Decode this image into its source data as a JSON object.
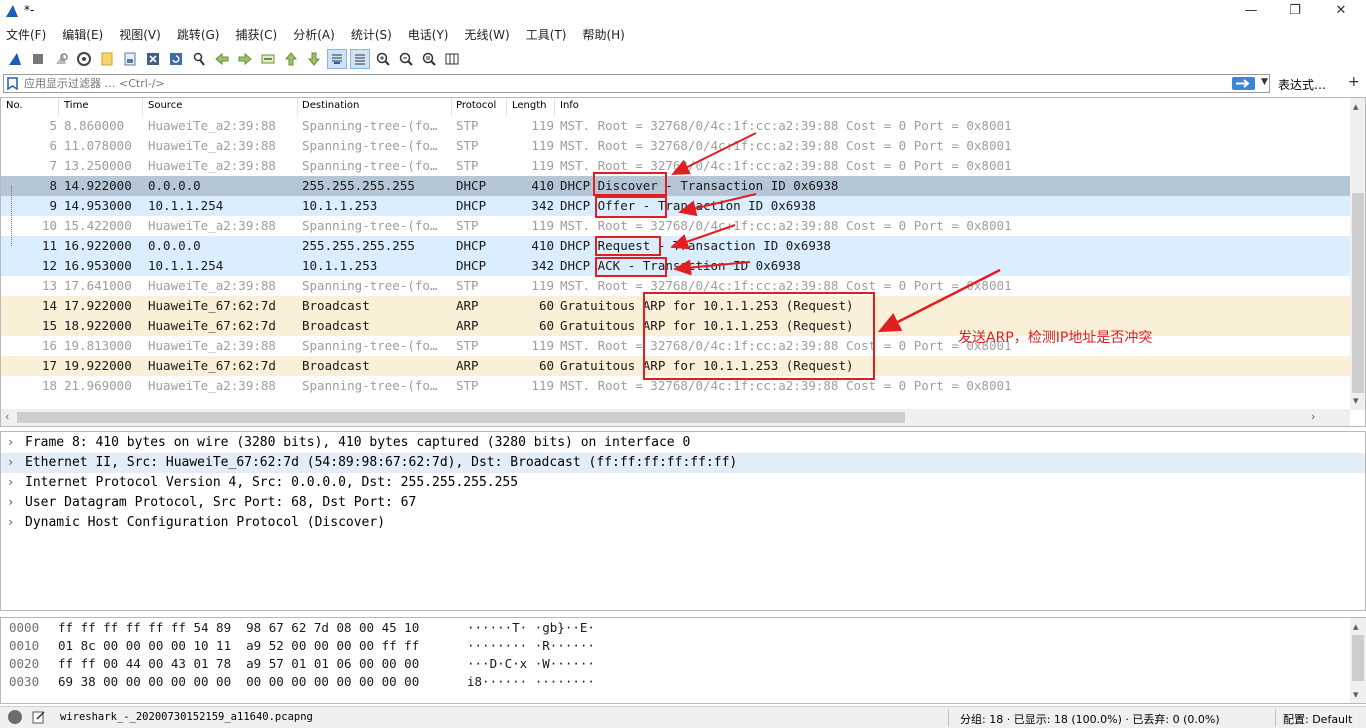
{
  "window": {
    "title": "*-",
    "minimize": "—",
    "maximize": "❐",
    "close": "✕"
  },
  "menus": [
    "文件(F)",
    "编辑(E)",
    "视图(V)",
    "跳转(G)",
    "捕获(C)",
    "分析(A)",
    "统计(S)",
    "电话(Y)",
    "无线(W)",
    "工具(T)",
    "帮助(H)"
  ],
  "toolbar": {
    "icons": [
      "shark-fin-start-icon",
      "stop-icon",
      "restart-icon",
      "capture-options-icon",
      "open-file-icon",
      "save-file-icon",
      "close-file-icon",
      "reload-icon",
      "find-icon",
      "go-back-icon",
      "go-forward-icon",
      "go-to-packet-icon",
      "go-first-icon",
      "go-last-icon",
      "autoscroll-icon",
      "colorize-icon",
      "zoom-in-icon",
      "zoom-out-icon",
      "zoom-normal-icon",
      "resize-columns-icon"
    ]
  },
  "filter": {
    "placeholder": "应用显示过滤器 … <Ctrl-/>",
    "expression_label": "表达式…",
    "add_label": "+"
  },
  "packet_list": {
    "columns": [
      "No.",
      "Time",
      "Source",
      "Destination",
      "Protocol",
      "Length",
      "Info"
    ],
    "rows": [
      {
        "no": "5",
        "time": "8.860000",
        "src": "HuaweiTe_a2:39:88",
        "dst": "Spanning-tree-(fo…",
        "proto": "STP",
        "len": "119",
        "info": "MST. Root = 32768/0/4c:1f:cc:a2:39:88  Cost = 0  Port = 0x8001",
        "kind": "stp"
      },
      {
        "no": "6",
        "time": "11.078000",
        "src": "HuaweiTe_a2:39:88",
        "dst": "Spanning-tree-(fo…",
        "proto": "STP",
        "len": "119",
        "info": "MST. Root = 32768/0/4c:1f:cc:a2:39:88  Cost = 0  Port = 0x8001",
        "kind": "stp"
      },
      {
        "no": "7",
        "time": "13.250000",
        "src": "HuaweiTe_a2:39:88",
        "dst": "Spanning-tree-(fo…",
        "proto": "STP",
        "len": "119",
        "info": "MST. Root = 32768/0/4c:1f:cc:a2:39:88  Cost = 0  Port = 0x8001",
        "kind": "stp"
      },
      {
        "no": "8",
        "time": "14.922000",
        "src": "0.0.0.0",
        "dst": "255.255.255.255",
        "proto": "DHCP",
        "len": "410",
        "info": "DHCP Discover - Transaction ID 0x6938",
        "kind": "dhcp sel"
      },
      {
        "no": "9",
        "time": "14.953000",
        "src": "10.1.1.254",
        "dst": "10.1.1.253",
        "proto": "DHCP",
        "len": "342",
        "info": "DHCP Offer    - Transaction ID 0x6938",
        "kind": "dhcp"
      },
      {
        "no": "10",
        "time": "15.422000",
        "src": "HuaweiTe_a2:39:88",
        "dst": "Spanning-tree-(fo…",
        "proto": "STP",
        "len": "119",
        "info": "MST. Root = 32768/0/4c:1f:cc:a2:39:88  Cost = 0  Port = 0x8001",
        "kind": "stp"
      },
      {
        "no": "11",
        "time": "16.922000",
        "src": "0.0.0.0",
        "dst": "255.255.255.255",
        "proto": "DHCP",
        "len": "410",
        "info": "DHCP Request  - Transaction ID 0x6938",
        "kind": "dhcp"
      },
      {
        "no": "12",
        "time": "16.953000",
        "src": "10.1.1.254",
        "dst": "10.1.1.253",
        "proto": "DHCP",
        "len": "342",
        "info": "DHCP ACK      - Transaction ID 0x6938",
        "kind": "dhcp"
      },
      {
        "no": "13",
        "time": "17.641000",
        "src": "HuaweiTe_a2:39:88",
        "dst": "Spanning-tree-(fo…",
        "proto": "STP",
        "len": "119",
        "info": "MST. Root = 32768/0/4c:1f:cc:a2:39:88  Cost = 0  Port = 0x8001",
        "kind": "stp"
      },
      {
        "no": "14",
        "time": "17.922000",
        "src": "HuaweiTe_67:62:7d",
        "dst": "Broadcast",
        "proto": "ARP",
        "len": "60",
        "info": "Gratuitous ARP for 10.1.1.253 (Request)",
        "kind": "arp"
      },
      {
        "no": "15",
        "time": "18.922000",
        "src": "HuaweiTe_67:62:7d",
        "dst": "Broadcast",
        "proto": "ARP",
        "len": "60",
        "info": "Gratuitous ARP for 10.1.1.253 (Request)",
        "kind": "arp"
      },
      {
        "no": "16",
        "time": "19.813000",
        "src": "HuaweiTe_a2:39:88",
        "dst": "Spanning-tree-(fo…",
        "proto": "STP",
        "len": "119",
        "info": "MST. Root = 32768/0/4c:1f:cc:a2:39:88  Cost = 0  Port = 0x8001",
        "kind": "stp"
      },
      {
        "no": "17",
        "time": "19.922000",
        "src": "HuaweiTe_67:62:7d",
        "dst": "Broadcast",
        "proto": "ARP",
        "len": "60",
        "info": "Gratuitous ARP for 10.1.1.253 (Request)",
        "kind": "arp"
      },
      {
        "no": "18",
        "time": "21.969000",
        "src": "HuaweiTe_a2:39:88",
        "dst": "Spanning-tree-(fo…",
        "proto": "STP",
        "len": "119",
        "info": "MST. Root = 32768/0/4c:1f:cc:a2:39:88  Cost = 0  Port = 0x8001",
        "kind": "stp"
      }
    ]
  },
  "details": [
    {
      "text": "Frame 8: 410 bytes on wire (3280 bits), 410 bytes captured (3280 bits) on interface 0",
      "hl": false
    },
    {
      "text": "Ethernet II, Src: HuaweiTe_67:62:7d (54:89:98:67:62:7d), Dst: Broadcast (ff:ff:ff:ff:ff:ff)",
      "hl": true
    },
    {
      "text": "Internet Protocol Version 4, Src: 0.0.0.0, Dst: 255.255.255.255",
      "hl": false
    },
    {
      "text": "User Datagram Protocol, Src Port: 68, Dst Port: 67",
      "hl": false
    },
    {
      "text": "Dynamic Host Configuration Protocol (Discover)",
      "hl": false
    }
  ],
  "bytes": [
    {
      "off": "0000",
      "hex": "ff ff ff ff ff ff 54 89  98 67 62 7d 08 00 45 10",
      "asc": "······T· ·gb}··E·"
    },
    {
      "off": "0010",
      "hex": "01 8c 00 00 00 00 10 11  a9 52 00 00 00 00 ff ff",
      "asc": "········ ·R······"
    },
    {
      "off": "0020",
      "hex": "ff ff 00 44 00 43 01 78  a9 57 01 01 06 00 00 00",
      "asc": "···D·C·x ·W······"
    },
    {
      "off": "0030",
      "hex": "69 38 00 00 00 00 00 00  00 00 00 00 00 00 00 00",
      "asc": "i8······ ········"
    }
  ],
  "status": {
    "file": "wireshark_-_20200730152159_a11640.pcapng",
    "stats": "分组: 18 · 已显示: 18 (100.0%) · 已丢弃: 0 (0.0%)",
    "profile": "配置: Default"
  },
  "annotation": {
    "note": "发送ARP，检测IP地址是否冲突",
    "color": "#e02020"
  }
}
